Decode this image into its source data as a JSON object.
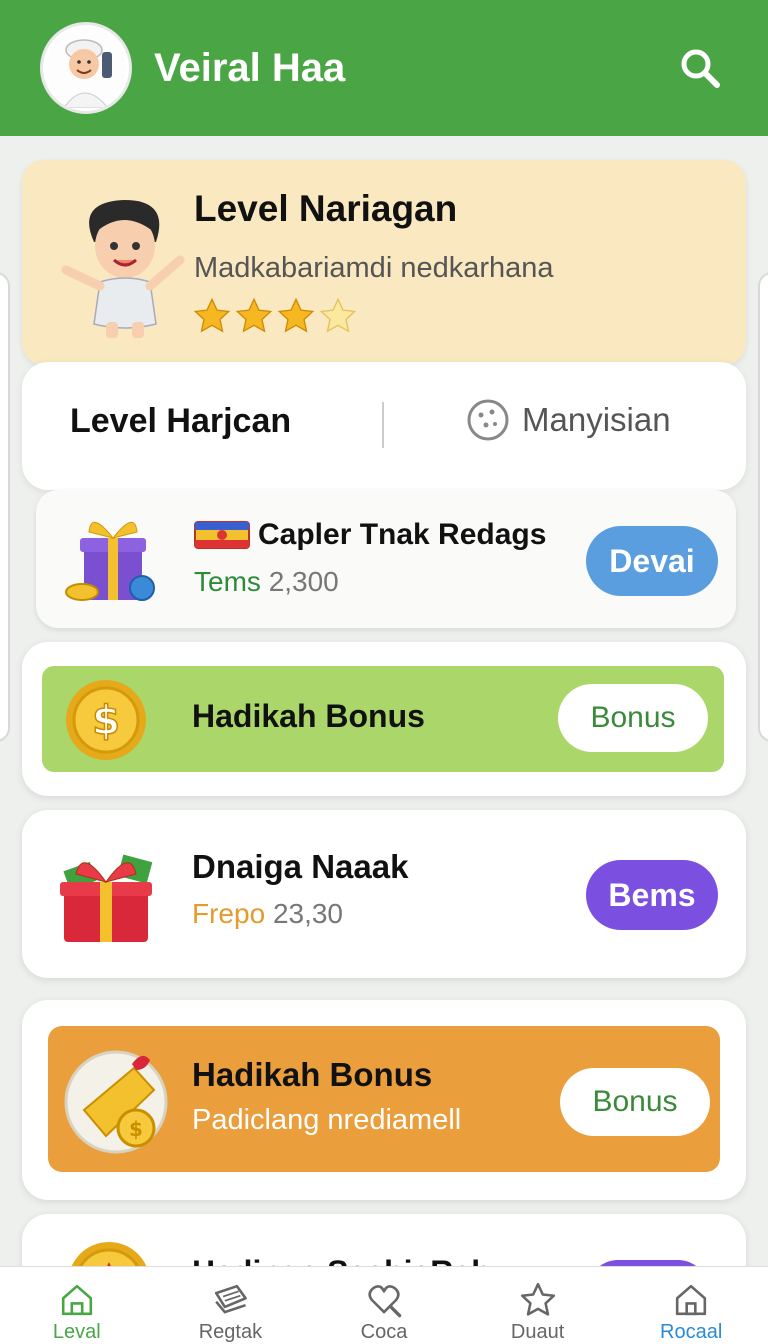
{
  "header": {
    "title": "Veiral Haa",
    "avatar_icon": "user-avatar-icon",
    "search_icon": "search-icon",
    "bg_color": "#4aa544"
  },
  "level_card": {
    "title": "Level Nariagan",
    "subtitle": "Madkabariamdi nedkarhana",
    "stars_filled": 3,
    "stars_total": 4
  },
  "tabs": {
    "left_label": "Level Harjcan",
    "right_label": "Manyisian",
    "right_icon": "cookie-icon"
  },
  "items": [
    {
      "title": "Capler Tnak Redags",
      "sub_prefix": "Tems",
      "sub_value": "2,300",
      "button": "Devai",
      "icon": "gift-box-icon",
      "badge_icon": "flag-badge-icon"
    },
    {
      "title": "Hadikah Bonus",
      "button": "Bonus",
      "icon": "dollar-coin-icon"
    },
    {
      "title": "Dnaiga Naaak",
      "sub_prefix": "Frepo",
      "sub_value": "23,30",
      "button": "Bems",
      "icon": "red-gift-icon"
    },
    {
      "title": "Hadikah Bonus",
      "subtitle": "Padiclang nrediamell",
      "button": "Bonus",
      "icon": "ticket-coin-icon"
    },
    {
      "title": "Hadinga SaabiaRah",
      "icon": "star-coin-icon"
    }
  ],
  "bottom_nav": [
    {
      "label": "Leval",
      "icon": "home-icon"
    },
    {
      "label": "Regtak",
      "icon": "layers-icon"
    },
    {
      "label": "Coca",
      "icon": "heart-search-icon"
    },
    {
      "label": "Duaut",
      "icon": "star-icon"
    },
    {
      "label": "Rocaal",
      "icon": "house-icon"
    }
  ]
}
